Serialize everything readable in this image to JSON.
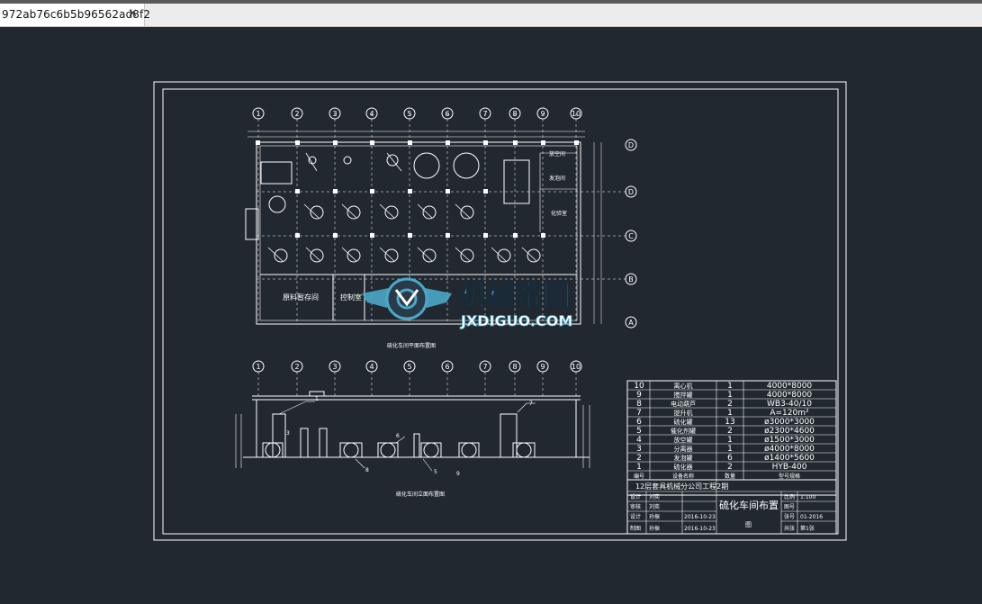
{
  "tab": {
    "title": "972ab76c6b5b96562ad8f2",
    "close_glyph": "✕"
  },
  "colors": {
    "background": "#212830",
    "lines": "#ffffff",
    "watermark_blue": "#4aa8c8",
    "watermark_dark": "#2a3a48"
  },
  "drawing": {
    "grid_top": [
      "1",
      "2",
      "3",
      "4",
      "5",
      "6",
      "7",
      "8",
      "9",
      "10"
    ],
    "grid_right": [
      "D",
      "D",
      "C",
      "B",
      "A"
    ],
    "plan_rooms": [
      "原料暂存间",
      "控制室",
      "化验室",
      "放空间",
      "发泡间"
    ],
    "plan_title": "硫化车间平面布置图",
    "elev_title": "硫化车间立面布置图",
    "watermark": {
      "cn": "机械帝国",
      "en": "JXDIGUO.COM"
    }
  },
  "equipment_table": {
    "rows": [
      {
        "no": "10",
        "name": "离心机",
        "qty": "1",
        "spec": "4000*8000"
      },
      {
        "no": "9",
        "name": "搅拌罐",
        "qty": "1",
        "spec": "4000*8000"
      },
      {
        "no": "8",
        "name": "电动葫芦",
        "qty": "2",
        "spec": "WB3-40/10"
      },
      {
        "no": "7",
        "name": "提升机",
        "qty": "1",
        "spec": "A=120m²"
      },
      {
        "no": "6",
        "name": "硫化罐",
        "qty": "13",
        "spec": "ø3000*3000"
      },
      {
        "no": "5",
        "name": "催化剂罐",
        "qty": "2",
        "spec": "ø2300*4600"
      },
      {
        "no": "4",
        "name": "放空罐",
        "qty": "1",
        "spec": "ø1500*3000"
      },
      {
        "no": "3",
        "name": "分离器",
        "qty": "1",
        "spec": "ø4000*8000"
      },
      {
        "no": "2",
        "name": "发泡罐",
        "qty": "6",
        "spec": "ø1400*5600"
      },
      {
        "no": "1",
        "name": "硫化器",
        "qty": "2",
        "spec": "HYB-400"
      }
    ],
    "header": {
      "no": "编号",
      "name": "设备名称",
      "qty": "数量",
      "spec": "型号规格"
    }
  },
  "title_block": {
    "project": "12层套具机械分公司工程2期",
    "drawing_title": "硫化车间布置",
    "figure_label": "图",
    "left_rows": [
      {
        "role": "设计",
        "name": "刘奕",
        "date": ""
      },
      {
        "role": "审核",
        "name": "刘奕",
        "date": ""
      },
      {
        "role": "设计",
        "name": "孙振",
        "date": "2016-10-23"
      },
      {
        "role": "制图",
        "name": "孙振",
        "date": "2016-10-23"
      }
    ],
    "right_rows": [
      {
        "k": "比例",
        "v": "1:100"
      },
      {
        "k": "图号",
        "v": ""
      },
      {
        "k": "张号",
        "v": "01-2016"
      },
      {
        "k": "共张",
        "v": "第1张"
      }
    ]
  }
}
